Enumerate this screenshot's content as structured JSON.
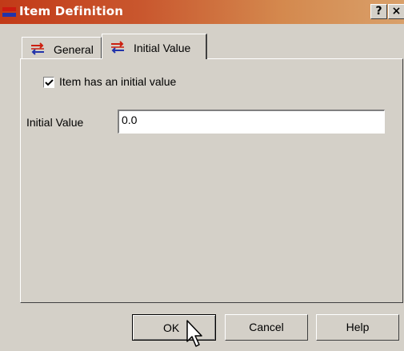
{
  "window": {
    "title": "Item Definition",
    "help_button_label": "?",
    "close_button_label": "×",
    "title_icon": "item-definition-icon"
  },
  "tabs": [
    {
      "label": "General",
      "icon": "item-arrows-icon",
      "active": false
    },
    {
      "label": "Initial Value",
      "icon": "item-arrows-icon",
      "active": true
    }
  ],
  "initial_value_tab": {
    "checkbox_label": "Item has an initial value",
    "checkbox_checked": true,
    "field_label": "Initial Value",
    "field_value": "0.0"
  },
  "buttons": {
    "ok": "OK",
    "cancel": "Cancel",
    "help": "Help"
  },
  "colors": {
    "titlebar_start": "#c23a18",
    "titlebar_end": "#d9a06a",
    "face": "#d4d0c8"
  }
}
